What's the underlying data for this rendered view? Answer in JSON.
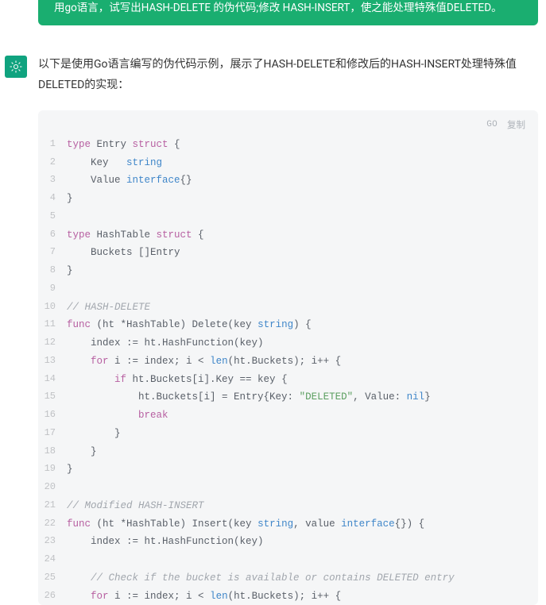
{
  "prompt": "用go语言，试写出HASH-DELETE 的伪代码;修改 HASH-INSERT，使之能处理特殊值DELETED。",
  "intro": "以下是使用Go语言编写的伪代码示例，展示了HASH-DELETE和修改后的HASH-INSERT处理特殊值DELETED的实现：",
  "lang_label": "GO",
  "copy_label": "复制",
  "code_lines": [
    [
      [
        "kw",
        "type"
      ],
      [
        "op",
        " Entry "
      ],
      [
        "kw",
        "struct"
      ],
      [
        "op",
        " {"
      ]
    ],
    [
      [
        "op",
        "    Key   "
      ],
      [
        "tyn",
        "string"
      ]
    ],
    [
      [
        "op",
        "    Value "
      ],
      [
        "tyn",
        "interface"
      ],
      [
        "op",
        "{}"
      ]
    ],
    [
      [
        "op",
        "}"
      ]
    ],
    [],
    [
      [
        "kw",
        "type"
      ],
      [
        "op",
        " HashTable "
      ],
      [
        "kw",
        "struct"
      ],
      [
        "op",
        " {"
      ]
    ],
    [
      [
        "op",
        "    Buckets []Entry"
      ]
    ],
    [
      [
        "op",
        "}"
      ]
    ],
    [],
    [
      [
        "cmt",
        "// HASH-DELETE"
      ]
    ],
    [
      [
        "kw",
        "func"
      ],
      [
        "op",
        " (ht *HashTable) Delete(key "
      ],
      [
        "tyn",
        "string"
      ],
      [
        "op",
        ") {"
      ]
    ],
    [
      [
        "op",
        "    index := ht.HashFunction(key)"
      ]
    ],
    [
      [
        "op",
        "    "
      ],
      [
        "kw",
        "for"
      ],
      [
        "op",
        " i := index; i < "
      ],
      [
        "tyn",
        "len"
      ],
      [
        "op",
        "(ht.Buckets); i++ {"
      ]
    ],
    [
      [
        "op",
        "        "
      ],
      [
        "kw",
        "if"
      ],
      [
        "op",
        " ht.Buckets[i].Key == key {"
      ]
    ],
    [
      [
        "op",
        "            ht.Buckets[i] = Entry{Key: "
      ],
      [
        "str",
        "\"DELETED\""
      ],
      [
        "op",
        ", Value: "
      ],
      [
        "nil",
        "nil"
      ],
      [
        "op",
        "}"
      ]
    ],
    [
      [
        "op",
        "            "
      ],
      [
        "kw",
        "break"
      ]
    ],
    [
      [
        "op",
        "        }"
      ]
    ],
    [
      [
        "op",
        "    }"
      ]
    ],
    [
      [
        "op",
        "}"
      ]
    ],
    [],
    [
      [
        "cmt",
        "// Modified HASH-INSERT"
      ]
    ],
    [
      [
        "kw",
        "func"
      ],
      [
        "op",
        " (ht *HashTable) Insert(key "
      ],
      [
        "tyn",
        "string"
      ],
      [
        "op",
        ", value "
      ],
      [
        "tyn",
        "interface"
      ],
      [
        "op",
        "{}) {"
      ]
    ],
    [
      [
        "op",
        "    index := ht.HashFunction(key)"
      ]
    ],
    [],
    [
      [
        "op",
        "    "
      ],
      [
        "cmt",
        "// Check if the bucket is available or contains DELETED entry"
      ]
    ],
    [
      [
        "op",
        "    "
      ],
      [
        "kw",
        "for"
      ],
      [
        "op",
        " i := index; i < "
      ],
      [
        "tyn",
        "len"
      ],
      [
        "op",
        "(ht.Buckets); i++ {"
      ]
    ]
  ]
}
